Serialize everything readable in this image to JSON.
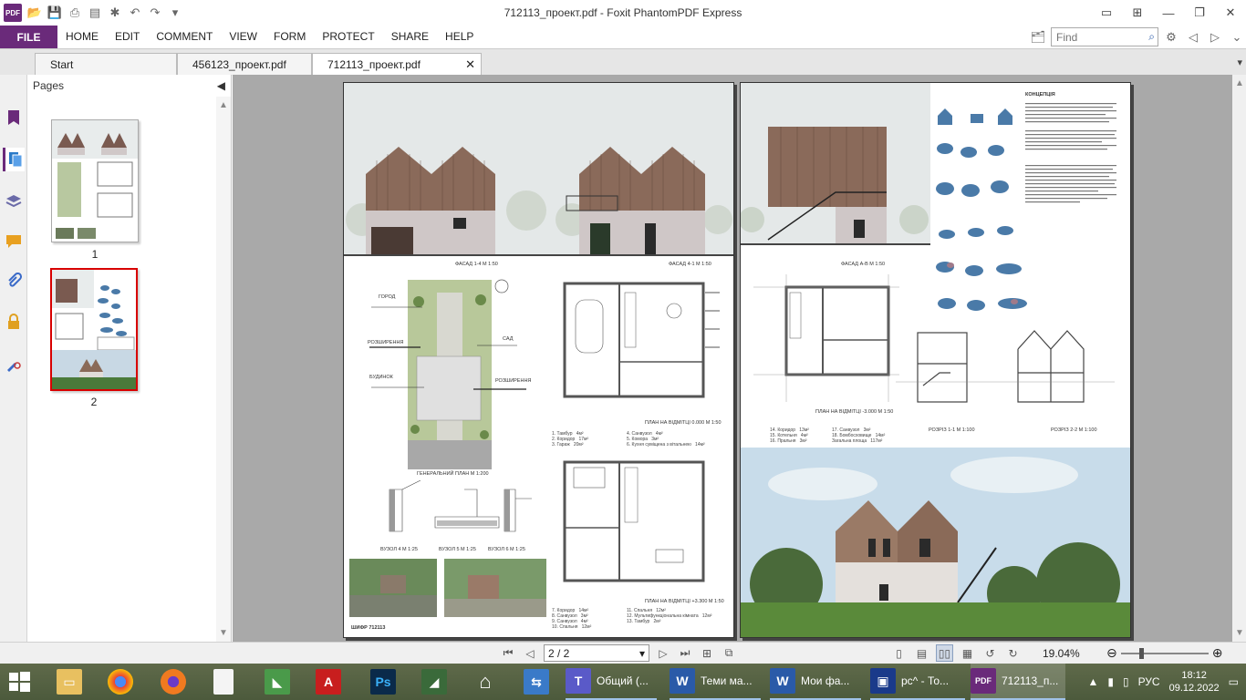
{
  "window": {
    "title": "712113_проект.pdf - Foxit PhantomPDF Express"
  },
  "ribbon": {
    "file": "FILE",
    "menus": [
      "HOME",
      "EDIT",
      "COMMENT",
      "VIEW",
      "FORM",
      "PROTECT",
      "SHARE",
      "HELP"
    ],
    "find_placeholder": "Find"
  },
  "tabs": [
    {
      "label": "Start"
    },
    {
      "label": "456123_проект.pdf"
    },
    {
      "label": "712113_проект.pdf",
      "active": true
    }
  ],
  "pages_panel": {
    "title": "Pages",
    "thumbs": [
      {
        "num": "1"
      },
      {
        "num": "2",
        "selected": true
      }
    ]
  },
  "document": {
    "page1": {
      "facade1": "ФАСАД 1-4 М 1:50",
      "facade2": "ФАСАД 4-1 М 1:50",
      "site_plan": "ГЕНЕРАЛЬНИЙ ПЛАН М 1:200",
      "plan0": "ПЛАН НА ВІДМІТЦІ 0.000 М 1:50",
      "plan1": "ПЛАН НА ВІДМІТЦІ +3.300 М 1:50",
      "site_labels": [
        "ГОРОД",
        "САД",
        "РОЗШИРЕННЯ",
        "БУДИНОК",
        "РОЗШИРЕННЯ"
      ],
      "details": [
        "ВУЗОЛ 4 М 1:25",
        "ВУЗОЛ 5 М 1:25",
        "ВУЗОЛ 6 М 1:25"
      ],
      "stamp": "ШИФР 712113",
      "legend0": [
        "1. Тамбур   4м²",
        "2. Коридор   17м²",
        "3. Гараж   20м²",
        "4. Санвузол   4м²",
        "5. Комора   3м²",
        "6. Кухня суміщена з вітальнею   14м²"
      ],
      "legend1": [
        "7. Коридор   14м²",
        "8. Санвузол   3м²",
        "9. Санвузол   4м²",
        "10. Спальня   12м²",
        "11. Спальня   12м²",
        "12. Мультифункціональна кімната   12м²",
        "13. Тамбур   2м²"
      ]
    },
    "page2": {
      "concept": "КОНЦЕПЦІЯ",
      "facade": "ФАСАД А-В М 1:50",
      "plan": "ПЛАН НА ВІДМІТЦІ -3.000 М 1:50",
      "section1": "РОЗРІЗ 1-1 М 1:100",
      "section2": "РОЗРІЗ 2-2 М 1:100",
      "legend": [
        "14. Коридор   13м²",
        "15. Котельня   4м²",
        "16. Пральня   3м²",
        "17. Санвузол   3м²",
        "18. Бомбосховище   14м²",
        "Загальна площа   117м²"
      ]
    }
  },
  "statusbar": {
    "page_indicator": "2 / 2",
    "zoom": "19.04%"
  },
  "taskbar": {
    "items": [
      "Общий (...",
      "Теми ма...",
      "Мои фа...",
      "рс^ - То...",
      "712113_п..."
    ],
    "lang": "РУС",
    "time": "18:12",
    "date": "09.12.2022"
  },
  "colors": {
    "accent": "#6a2a7a",
    "selection": "#d80000",
    "doc_bg": "#a9a9a9"
  }
}
